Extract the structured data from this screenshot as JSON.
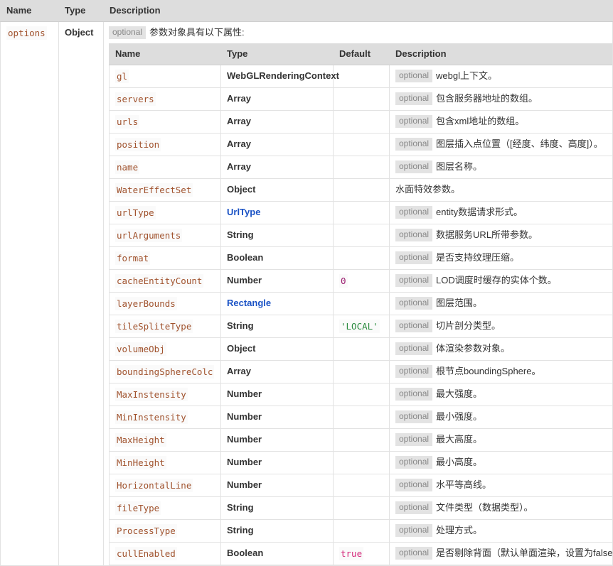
{
  "outer_table": {
    "columns": [
      "Name",
      "Type",
      "Description"
    ],
    "row": {
      "name": "options",
      "type": "Object",
      "optional_label": "optional",
      "intro": "参数对象具有以下属性:"
    }
  },
  "inner_table": {
    "columns": [
      "Name",
      "Type",
      "Default",
      "Description"
    ],
    "optional_label": "optional",
    "rows": [
      {
        "name": "gl",
        "type": "WebGLRenderingContext",
        "type_link": false,
        "default": "",
        "default_kind": "",
        "optional": true,
        "desc": "webgl上下文。"
      },
      {
        "name": "servers",
        "type": "Array",
        "type_link": false,
        "default": "",
        "default_kind": "",
        "optional": true,
        "desc": "包含服务器地址的数组。"
      },
      {
        "name": "urls",
        "type": "Array",
        "type_link": false,
        "default": "",
        "default_kind": "",
        "optional": true,
        "desc": "包含xml地址的数组。"
      },
      {
        "name": "position",
        "type": "Array",
        "type_link": false,
        "default": "",
        "default_kind": "",
        "optional": true,
        "desc": "图层插入点位置（[经度、纬度、高度]）。"
      },
      {
        "name": "name",
        "type": "Array",
        "type_link": false,
        "default": "",
        "default_kind": "",
        "optional": true,
        "desc": "图层名称。"
      },
      {
        "name": "WaterEffectSet",
        "type": "Object",
        "type_link": false,
        "default": "",
        "default_kind": "",
        "optional": false,
        "desc": "水面特效参数。"
      },
      {
        "name": "urlType",
        "type": "UrlType",
        "type_link": true,
        "default": "",
        "default_kind": "",
        "optional": true,
        "desc": "entity数据请求形式。"
      },
      {
        "name": "urlArguments",
        "type": "String",
        "type_link": false,
        "default": "",
        "default_kind": "",
        "optional": true,
        "desc": "数据服务URL所带参数。"
      },
      {
        "name": "format",
        "type": "Boolean",
        "type_link": false,
        "default": "",
        "default_kind": "",
        "optional": true,
        "desc": "是否支持纹理压缩。"
      },
      {
        "name": "cacheEntityCount",
        "type": "Number",
        "type_link": false,
        "default": "0",
        "default_kind": "num",
        "optional": true,
        "desc": "LOD调度时缓存的实体个数。"
      },
      {
        "name": "layerBounds",
        "type": "Rectangle",
        "type_link": true,
        "default": "",
        "default_kind": "",
        "optional": true,
        "desc": "图层范围。"
      },
      {
        "name": "tileSpliteType",
        "type": "String",
        "type_link": false,
        "default": "'LOCAL'",
        "default_kind": "str",
        "optional": true,
        "desc": "切片剖分类型。"
      },
      {
        "name": "volumeObj",
        "type": "Object",
        "type_link": false,
        "default": "",
        "default_kind": "",
        "optional": true,
        "desc": "体渲染参数对象。"
      },
      {
        "name": "boundingSphereColc",
        "type": "Array",
        "type_link": false,
        "default": "",
        "default_kind": "",
        "optional": true,
        "desc": "根节点boundingSphere。"
      },
      {
        "name": "MaxInstensity",
        "type": "Number",
        "type_link": false,
        "default": "",
        "default_kind": "",
        "optional": true,
        "desc": "最大强度。"
      },
      {
        "name": "MinInstensity",
        "type": "Number",
        "type_link": false,
        "default": "",
        "default_kind": "",
        "optional": true,
        "desc": "最小强度。"
      },
      {
        "name": "MaxHeight",
        "type": "Number",
        "type_link": false,
        "default": "",
        "default_kind": "",
        "optional": true,
        "desc": "最大高度。"
      },
      {
        "name": "MinHeight",
        "type": "Number",
        "type_link": false,
        "default": "",
        "default_kind": "",
        "optional": true,
        "desc": "最小高度。"
      },
      {
        "name": "HorizontalLine",
        "type": "Number",
        "type_link": false,
        "default": "",
        "default_kind": "",
        "optional": true,
        "desc": "水平等高线。"
      },
      {
        "name": "fileType",
        "type": "String",
        "type_link": false,
        "default": "",
        "default_kind": "",
        "optional": true,
        "desc": "文件类型（数据类型）。"
      },
      {
        "name": "ProcessType",
        "type": "String",
        "type_link": false,
        "default": "",
        "default_kind": "",
        "optional": true,
        "desc": "处理方式。"
      },
      {
        "name": "cullEnabled",
        "type": "Boolean",
        "type_link": false,
        "default": "true",
        "default_kind": "bool",
        "optional": true,
        "desc": "是否剔除背面（默认单面渲染，设置为false则为双面渲染）。"
      }
    ]
  },
  "colors": {
    "header_bg": "#dddddd",
    "param_name": "#a0522d",
    "type_link": "#1a52c5",
    "badge_bg": "#e3e3e3",
    "badge_text": "#888888",
    "string_literal": "#2a8a3e",
    "number_literal": "#9a1b6e",
    "boolean_literal": "#d4287a",
    "border": "#e2e2e2"
  }
}
